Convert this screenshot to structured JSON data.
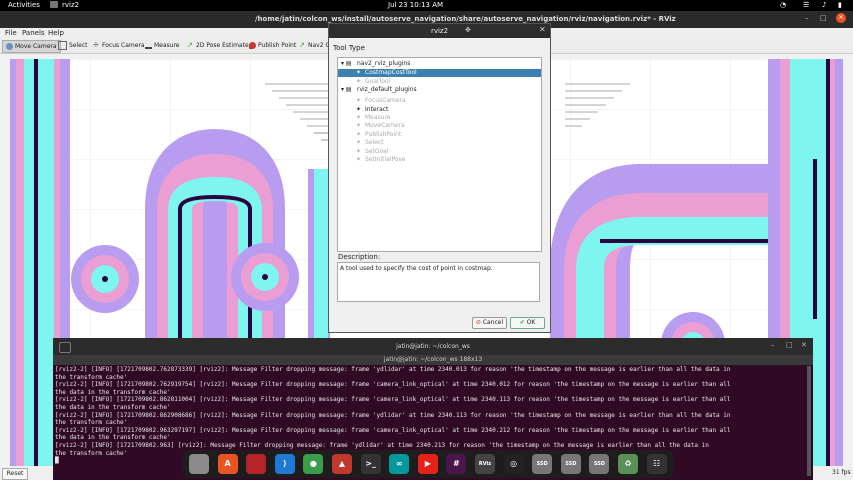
{
  "topbar": {
    "activities": "Activities",
    "app": "rviz2",
    "clock": "Jul 23  10:13 AM"
  },
  "window": {
    "title": "/home/jatin/colcon_ws/install/autoserve_navigation/share/autoserve_navigation/rviz/navigation.rviz* - RViz"
  },
  "menu": [
    "File",
    "Panels",
    "Help"
  ],
  "toolbar": [
    {
      "label": "Move Camera",
      "icon": "move-camera-icon",
      "active": true
    },
    {
      "label": "Select",
      "icon": "select-icon"
    },
    {
      "label": "Focus Camera",
      "icon": "focus-camera-icon"
    },
    {
      "label": "Measure",
      "icon": "measure-icon"
    },
    {
      "label": "2D Pose Estimate",
      "icon": "pose-estimate-icon"
    },
    {
      "label": "Publish Point",
      "icon": "publish-point-icon"
    },
    {
      "label": "Nav2 Co",
      "icon": "nav2-icon"
    }
  ],
  "dialog": {
    "title": "rviz2",
    "tool_type_label": "Tool Type",
    "description_label": "Description:",
    "description": "A tool used to specify the cost of point in costmap.",
    "cancel": "Cancel",
    "ok": "OK",
    "tree": [
      {
        "label": "nav2_rviz_plugins",
        "level": 0,
        "type": "folder"
      },
      {
        "label": "CostmapCostTool",
        "level": 1,
        "selected": true
      },
      {
        "label": "GoalTool",
        "level": 1,
        "dim": true
      },
      {
        "label": "rviz_default_plugins",
        "level": 0,
        "type": "folder"
      },
      {
        "label": "FocusCamera",
        "level": 1,
        "dim": true
      },
      {
        "label": "Interact",
        "level": 1
      },
      {
        "label": "Measure",
        "level": 1,
        "dim": true
      },
      {
        "label": "MoveCamera",
        "level": 1,
        "dim": true
      },
      {
        "label": "PublishPoint",
        "level": 1,
        "dim": true
      },
      {
        "label": "Select",
        "level": 1,
        "dim": true
      },
      {
        "label": "SetGoal",
        "level": 1,
        "dim": true
      },
      {
        "label": "SetInitialPose",
        "level": 1,
        "dim": true
      }
    ]
  },
  "terminal": {
    "title": "jatin@jatin: ~/colcon_ws",
    "subtitle": "jatin@jatin: ~/colcon_ws 188x13",
    "lines": [
      "[rviz2-2] [INFO] [1721709802.762873339] [rviz2]: Message Filter dropping message: frame 'ydlidar' at time 2340.013 for reason 'the timestamp on the message is earlier than all the data in",
      "the transform cache'",
      "[rviz2-2] [INFO] [1721709802.762919754] [rviz2]: Message Filter dropping message: frame 'camera_link_optical' at time 2340.012 for reason 'the timestamp on the message is earlier than all",
      "the data in the transform cache'",
      "[rviz2-2] [INFO] [1721709802.862811004] [rviz2]: Message Filter dropping message: frame 'camera_link_optical' at time 2340.113 for reason 'the timestamp on the message is earlier than all",
      "the data in the transform cache'",
      "[rviz2-2] [INFO] [1721709802.862908686] [rviz2]: Message Filter dropping message: frame 'ydlidar' at time 2340.113 for reason 'the timestamp on the message is earlier than all the data in",
      "the transform cache'",
      "[rviz2-2] [INFO] [1721709802.963297197] [rviz2]: Message Filter dropping message: frame 'camera_link_optical' at time 2340.212 for reason 'the timestamp on the message is earlier than all",
      "the data in the transform cache'",
      "[rviz2-2] [INFO] [1721709802.963] [rviz2]: Message Filter dropping message: frame 'ydlidar' at time 2340.213 for reason 'the timestamp on the message is earlier than all the data in",
      "the transform cache'",
      "█"
    ]
  },
  "statusbar": {
    "reset": "Reset",
    "fps": "31 fps"
  },
  "dock": [
    {
      "name": "files-icon",
      "color": "#8a8a8a",
      "glyph": ""
    },
    {
      "name": "app-center-icon",
      "color": "#e95420",
      "glyph": "A"
    },
    {
      "name": "screen-recorder-icon",
      "color": "#b5242a",
      "glyph": ""
    },
    {
      "name": "vscode-icon",
      "color": "#1f7ad6",
      "glyph": "⟩"
    },
    {
      "name": "chrome-icon",
      "color": "#3a9d4a",
      "glyph": "●"
    },
    {
      "name": "stacer-icon",
      "color": "#c0392b",
      "glyph": "▲"
    },
    {
      "name": "terminal-icon",
      "color": "#333",
      "glyph": ">_"
    },
    {
      "name": "arduino-icon",
      "color": "#00979d",
      "glyph": "∞"
    },
    {
      "name": "youtube-music-icon",
      "color": "#e62117",
      "glyph": "▶"
    },
    {
      "name": "slack-icon",
      "color": "#4a154b",
      "glyph": "#"
    },
    {
      "name": "rviz-icon",
      "color": "#444",
      "glyph": "RViz"
    },
    {
      "name": "obs-icon",
      "color": "#222",
      "glyph": "◎"
    },
    {
      "name": "ssd-icon-1",
      "color": "#777",
      "glyph": "SSD"
    },
    {
      "name": "ssd-icon-2",
      "color": "#777",
      "glyph": "SSD"
    },
    {
      "name": "ssd-icon-3",
      "color": "#777",
      "glyph": "SSD"
    },
    {
      "name": "trash-icon",
      "color": "#5a8f5a",
      "glyph": "♻"
    },
    {
      "name": "app-grid-icon",
      "color": "#333",
      "glyph": "☷"
    }
  ]
}
